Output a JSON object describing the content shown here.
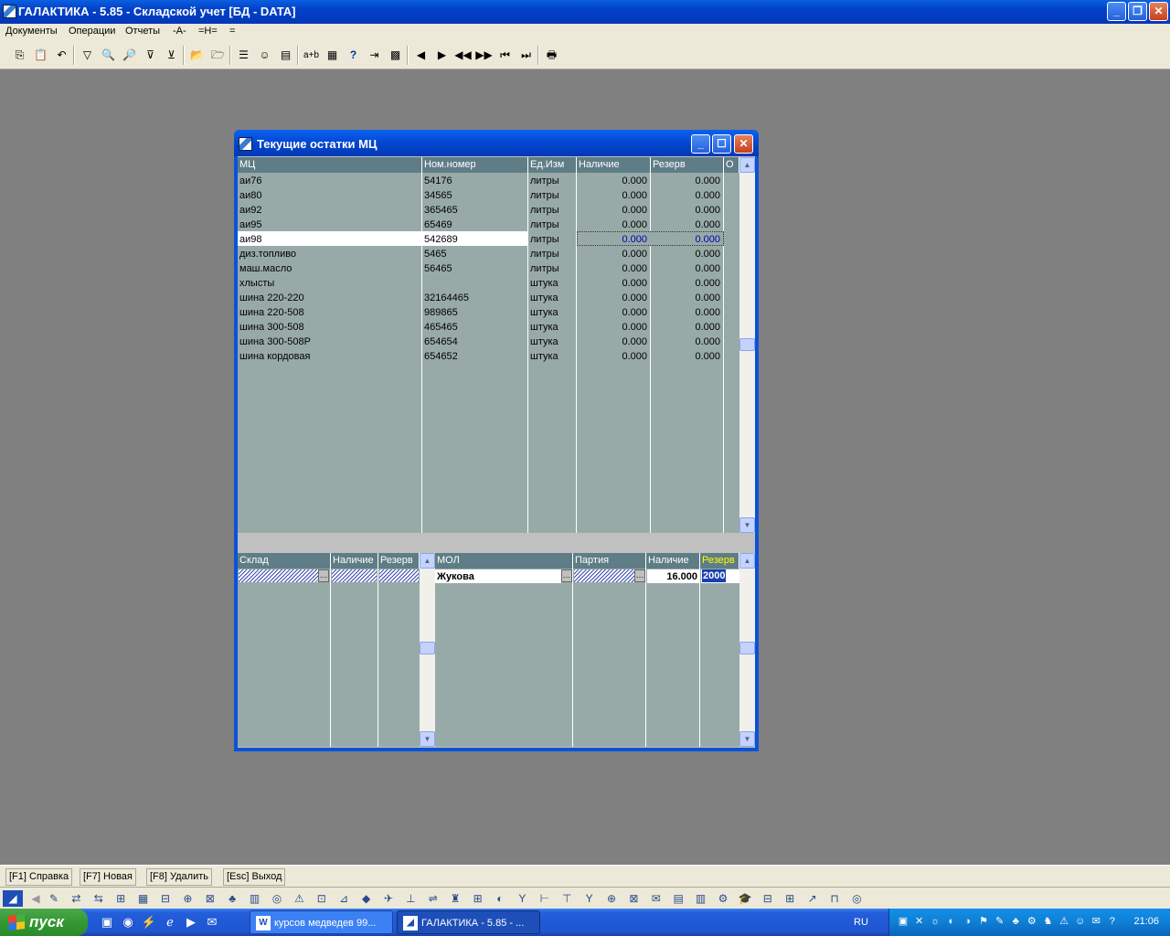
{
  "app": {
    "title": "ГАЛАКТИКА - 5.85 - Складской учет [БД - DATA]"
  },
  "menu": [
    "Документы",
    "Операции",
    "Отчеты",
    "-A-",
    "=H=",
    "="
  ],
  "window": {
    "title": "Текущие остатки МЦ"
  },
  "upper_grid": {
    "columns": [
      "МЦ",
      "Ном.номер",
      "Ед.Изм",
      "Наличие",
      "Резерв",
      "О"
    ],
    "rows": [
      [
        "аи76",
        "54176",
        "литры",
        "0.000",
        "0.000"
      ],
      [
        "аи80",
        "34565",
        "литры",
        "0.000",
        "0.000"
      ],
      [
        "аи92",
        "365465",
        "литры",
        "0.000",
        "0.000"
      ],
      [
        "аи95",
        "65469",
        "литры",
        "0.000",
        "0.000"
      ],
      [
        "аи98",
        "542689",
        "литры",
        "0.000",
        "0.000"
      ],
      [
        "диз.топливо",
        "5465",
        "литры",
        "0.000",
        "0.000"
      ],
      [
        "маш.масло",
        "56465",
        "литры",
        "0.000",
        "0.000"
      ],
      [
        "хлысты",
        "",
        "штука",
        "0.000",
        "0.000"
      ],
      [
        "шина 220-220",
        "32164465",
        "штука",
        "0.000",
        "0.000"
      ],
      [
        "шина 220-508",
        "989865",
        "штука",
        "0.000",
        "0.000"
      ],
      [
        "шина 300-508",
        "465465",
        "штука",
        "0.000",
        "0.000"
      ],
      [
        "шина 300-508Р",
        "654654",
        "штука",
        "0.000",
        "0.000"
      ],
      [
        "шина кордовая",
        "654652",
        "штука",
        "0.000",
        "0.000"
      ]
    ],
    "selected_row": 4
  },
  "lower_left_grid": {
    "columns": [
      "Склад",
      "Наличие",
      "Резерв"
    ]
  },
  "lower_right_grid": {
    "columns": [
      "МОЛ",
      "Партия",
      "Наличие",
      "Резерв"
    ],
    "row": {
      "mol": "Жукова",
      "nalichie": "16.000",
      "rezerv": "2000"
    }
  },
  "function_keys": [
    "[F1] Справка",
    "[F7] Новая",
    "[F8] Удалить",
    "[Esc] Выход"
  ],
  "taskbar": {
    "start_label": "пуск",
    "tasks": [
      "курсов медведев 99...",
      "ГАЛАКТИКА - 5.85 - ..."
    ],
    "lang": "RU",
    "clock": "21:06"
  },
  "colors": {
    "grid_bg": "#98aaa8",
    "header_bg": "#5f7d86",
    "title_blue": "#0346d0",
    "desktop_gray": "#808080",
    "rezerv_header_text": "#ffff00"
  }
}
